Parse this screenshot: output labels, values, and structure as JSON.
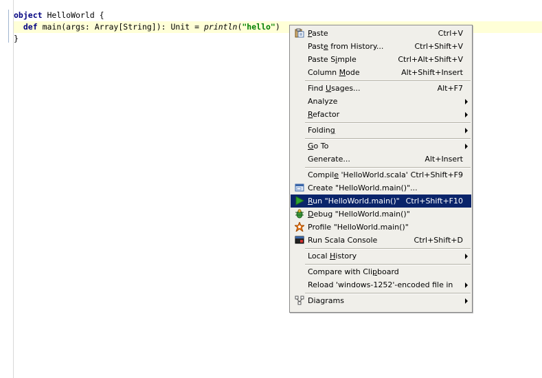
{
  "editor": {
    "lines": [
      {
        "parts": [
          {
            "t": "object",
            "c": "kw"
          },
          {
            "t": " HelloWorld {",
            "c": ""
          }
        ]
      },
      {
        "parts": [
          {
            "t": "  ",
            "c": ""
          },
          {
            "t": "def",
            "c": "kw"
          },
          {
            "t": " main(args: Array[String]): Unit = ",
            "c": ""
          },
          {
            "t": "println",
            "c": "it"
          },
          {
            "t": "(",
            "c": ""
          },
          {
            "t": "\"hello\"",
            "c": "str"
          },
          {
            "t": ")",
            "c": ""
          }
        ]
      },
      {
        "parts": [
          {
            "t": "}",
            "c": ""
          }
        ]
      }
    ]
  },
  "context_menu": {
    "groups": [
      [
        {
          "label": "Paste",
          "u": 0,
          "shortcut": "Ctrl+V",
          "icon": "paste-icon",
          "submenu": false
        },
        {
          "label": "Paste from History...",
          "u": 4,
          "shortcut": "Ctrl+Shift+V",
          "icon": "",
          "submenu": false
        },
        {
          "label": "Paste Simple",
          "u": 7,
          "shortcut": "Ctrl+Alt+Shift+V",
          "icon": "",
          "submenu": false
        },
        {
          "label": "Column Mode",
          "u": 7,
          "shortcut": "Alt+Shift+Insert",
          "icon": "",
          "submenu": false
        }
      ],
      [
        {
          "label": "Find Usages...",
          "u": 5,
          "shortcut": "Alt+F7",
          "icon": "",
          "submenu": false
        },
        {
          "label": "Analyze",
          "u": -1,
          "shortcut": "",
          "icon": "",
          "submenu": true
        },
        {
          "label": "Refactor",
          "u": 0,
          "shortcut": "",
          "icon": "",
          "submenu": true
        }
      ],
      [
        {
          "label": "Folding",
          "u": 6,
          "shortcut": "",
          "icon": "",
          "submenu": true
        }
      ],
      [
        {
          "label": "Go To",
          "u": 0,
          "shortcut": "",
          "icon": "",
          "submenu": true
        },
        {
          "label": "Generate...",
          "u": -1,
          "shortcut": "Alt+Insert",
          "icon": "",
          "submenu": false
        }
      ],
      [
        {
          "label": "Compile 'HelloWorld.scala'",
          "u": 6,
          "shortcut": "Ctrl+Shift+F9",
          "icon": "",
          "submenu": false
        },
        {
          "label": "Create  \"HelloWorld.main()\"...",
          "u": -1,
          "shortcut": "",
          "icon": "create-config-icon",
          "submenu": false
        },
        {
          "label": "Run \"HelloWorld.main()\"",
          "u": 0,
          "shortcut": "Ctrl+Shift+F10",
          "icon": "run-icon",
          "submenu": false,
          "highlighted": true
        },
        {
          "label": "Debug \"HelloWorld.main()\"",
          "u": 0,
          "shortcut": "",
          "icon": "debug-icon",
          "submenu": false
        },
        {
          "label": "Profile \"HelloWorld.main()\"",
          "u": -1,
          "shortcut": "",
          "icon": "profile-icon",
          "submenu": false
        },
        {
          "label": "Run Scala Console",
          "u": -1,
          "shortcut": "Ctrl+Shift+D",
          "icon": "scala-console-icon",
          "submenu": false
        }
      ],
      [
        {
          "label": "Local History",
          "u": 6,
          "shortcut": "",
          "icon": "",
          "submenu": true
        }
      ],
      [
        {
          "label": "Compare with Clipboard",
          "u": 16,
          "shortcut": "",
          "icon": "",
          "submenu": false
        },
        {
          "label": "Reload 'windows-1252'-encoded file in",
          "u": -1,
          "shortcut": "",
          "icon": "",
          "submenu": true
        }
      ],
      [
        {
          "label": "Diagrams",
          "u": -1,
          "shortcut": "",
          "icon": "diagrams-icon",
          "submenu": true
        }
      ]
    ]
  },
  "colors": {
    "highlight": "#0a246a",
    "current_line": "#ffffd7",
    "keyword": "#000080",
    "string": "#008000"
  }
}
